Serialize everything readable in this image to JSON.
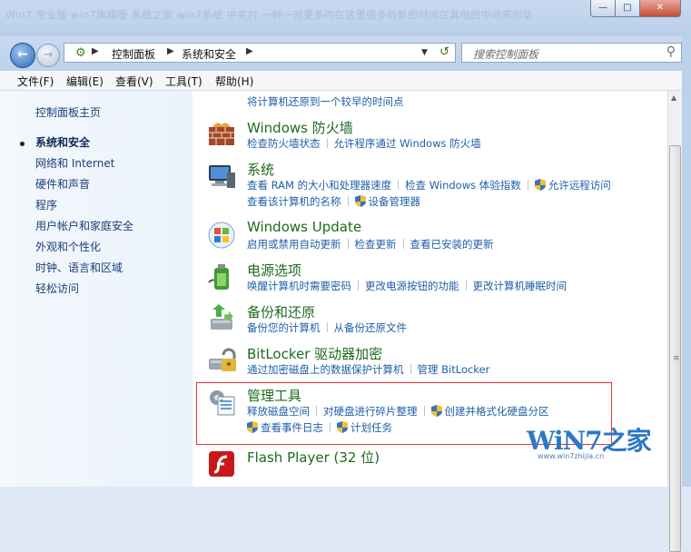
{
  "titlebar": {
    "ghost_text": "Win7 专业版 win7旗舰版 系统之家 win7系统 中关村 一种一对更多的在这里很多的新的时间在其他的中间来的话"
  },
  "window_buttons": {
    "min": "—",
    "max": "□",
    "close": "✕"
  },
  "address": {
    "icon": "control-panel-icon",
    "crumbs": [
      "控制面板",
      "系统和安全"
    ],
    "search_placeholder": "搜索控制面板"
  },
  "menu": [
    "文件(F)",
    "编辑(E)",
    "查看(V)",
    "工具(T)",
    "帮助(H)"
  ],
  "sidebar": {
    "items": [
      {
        "label": "控制面板主页",
        "current": false
      },
      {
        "label": "系统和安全",
        "current": true
      },
      {
        "label": "网络和 Internet",
        "current": false
      },
      {
        "label": "硬件和声音",
        "current": false
      },
      {
        "label": "程序",
        "current": false
      },
      {
        "label": "用户帐户和家庭安全",
        "current": false
      },
      {
        "label": "外观和个性化",
        "current": false
      },
      {
        "label": "时钟、语言和区域",
        "current": false
      },
      {
        "label": "轻松访问",
        "current": false
      }
    ]
  },
  "main": {
    "top_partial": "将计算机还原到一个较早的时间点",
    "categories": [
      {
        "title": "Windows 防火墙",
        "icon": "firewall-icon",
        "lines": [
          [
            "检查防火墙状态",
            "允许程序通过 Windows 防火墙"
          ]
        ]
      },
      {
        "title": "系统",
        "icon": "system-icon",
        "lines": [
          [
            "查看 RAM 的大小和处理器速度",
            "检查 Windows 体验指数",
            "允许远程访问"
          ],
          [
            "查看该计算机的名称",
            "设备管理器"
          ]
        ]
      },
      {
        "title": "Windows Update",
        "icon": "windows-update-icon",
        "lines": [
          [
            "启用或禁用自动更新",
            "检查更新",
            "查看已安装的更新"
          ]
        ]
      },
      {
        "title": "电源选项",
        "icon": "power-options-icon",
        "lines": [
          [
            "唤醒计算机时需要密码",
            "更改电源按钮的功能",
            "更改计算机睡眠时间"
          ]
        ]
      },
      {
        "title": "备份和还原",
        "icon": "backup-restore-icon",
        "lines": [
          [
            "备份您的计算机",
            "从备份还原文件"
          ]
        ]
      },
      {
        "title": "BitLocker 驱动器加密",
        "icon": "bitlocker-icon",
        "lines": [
          [
            "通过加密磁盘上的数据保护计算机",
            "管理 BitLocker"
          ]
        ]
      },
      {
        "title": "管理工具",
        "icon": "admin-tools-icon",
        "lines": [
          [
            "释放磁盘空间",
            "对硬盘进行碎片整理",
            "创建并格式化硬盘分区"
          ],
          [
            "查看事件日志",
            "计划任务"
          ]
        ]
      },
      {
        "title": "Flash Player (32 位)",
        "icon": "flash-player-icon",
        "lines": []
      }
    ]
  },
  "watermark": {
    "main": "WiN7之家",
    "sub": "www.win7zhijia.cn"
  },
  "colors": {
    "category_title": "#1e6b1e",
    "link": "#1f5fa8",
    "highlight": "#e03434"
  }
}
